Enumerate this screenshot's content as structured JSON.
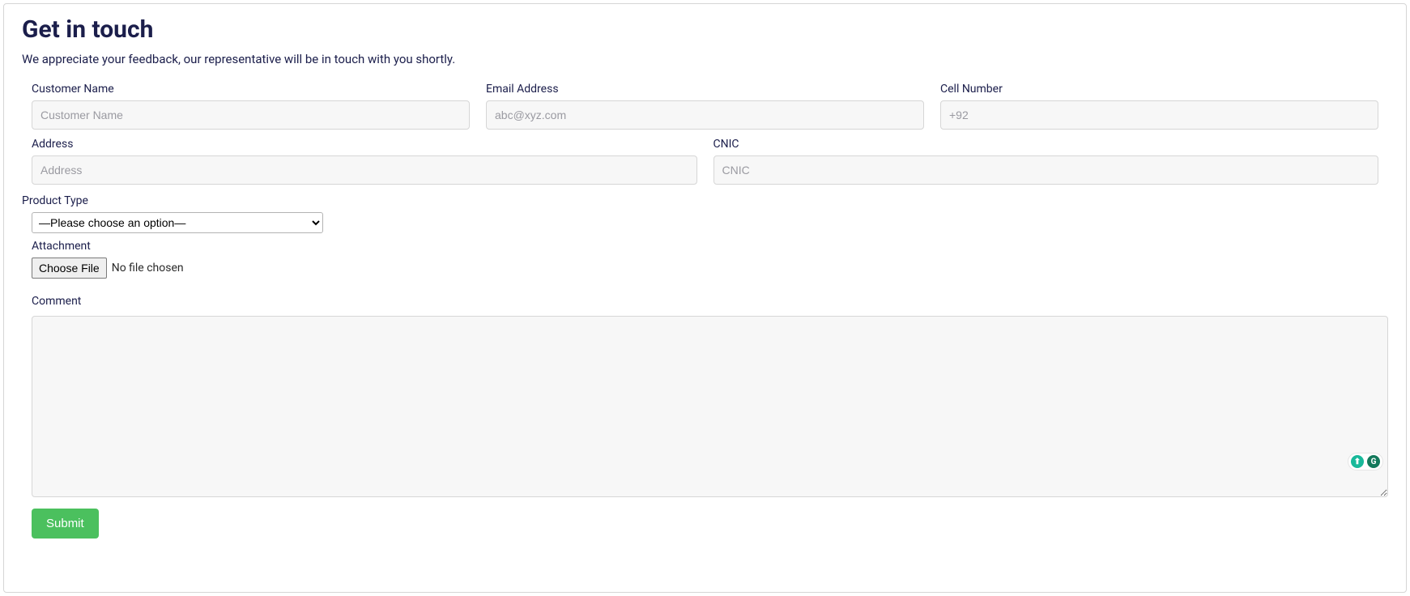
{
  "header": {
    "title": "Get in touch",
    "subtitle": "We appreciate your feedback, our representative will be in touch with you shortly."
  },
  "fields": {
    "customerName": {
      "label": "Customer Name",
      "placeholder": "Customer Name"
    },
    "email": {
      "label": "Email Address",
      "placeholder": "abc@xyz.com"
    },
    "cell": {
      "label": "Cell Number",
      "placeholder": "+92"
    },
    "address": {
      "label": "Address",
      "placeholder": "Address"
    },
    "cnic": {
      "label": "CNIC",
      "placeholder": "CNIC"
    },
    "productType": {
      "label": "Product Type",
      "selected": "—Please choose an option—"
    },
    "attachment": {
      "label": "Attachment",
      "button": "Choose File",
      "status": "No file chosen"
    },
    "comment": {
      "label": "Comment"
    }
  },
  "actions": {
    "submit": "Submit"
  },
  "widget": {
    "arrow_glyph": "⬆",
    "g_glyph": "G"
  }
}
